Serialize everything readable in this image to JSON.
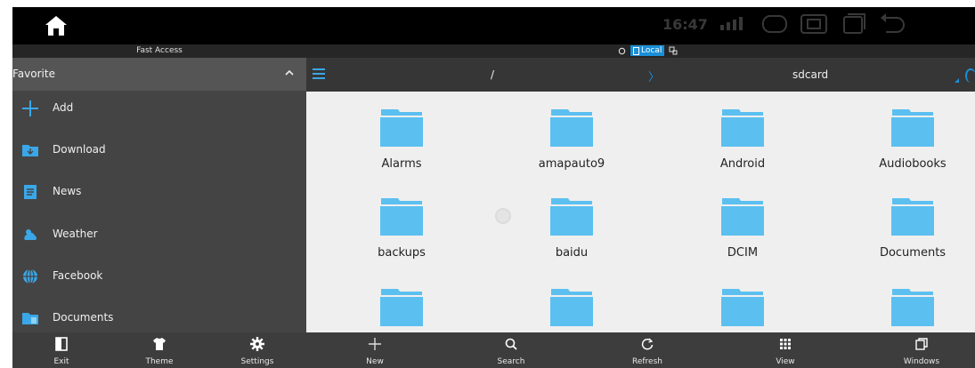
{
  "status_bar": {
    "home_icon": "home-icon",
    "time": "16:47"
  },
  "fast_access": {
    "title": "Fast Access"
  },
  "location": {
    "label": "Local"
  },
  "favorites": {
    "title": "Favorite",
    "items": [
      {
        "label": "Add",
        "icon": "plus-icon"
      },
      {
        "label": "Download",
        "icon": "download-folder-icon"
      },
      {
        "label": "News",
        "icon": "news-icon"
      },
      {
        "label": "Weather",
        "icon": "weather-icon"
      },
      {
        "label": "Facebook",
        "icon": "globe-icon"
      },
      {
        "label": "Documents",
        "icon": "documents-folder-icon"
      }
    ]
  },
  "path_bar": {
    "root": "/",
    "separator": "〉",
    "current": "sdcard"
  },
  "files": [
    {
      "name": "Alarms"
    },
    {
      "name": "amapauto9"
    },
    {
      "name": "Android"
    },
    {
      "name": "Audiobooks"
    },
    {
      "name": "backups"
    },
    {
      "name": "baidu"
    },
    {
      "name": "DCIM"
    },
    {
      "name": "Documents"
    },
    {
      "name": ""
    },
    {
      "name": ""
    },
    {
      "name": ""
    },
    {
      "name": ""
    }
  ],
  "bottom_left": [
    {
      "label": "Exit",
      "icon": "exit-icon"
    },
    {
      "label": "Theme",
      "icon": "tshirt-icon"
    },
    {
      "label": "Settings",
      "icon": "gear-icon"
    }
  ],
  "bottom_right": [
    {
      "label": "New",
      "icon": "plus-icon"
    },
    {
      "label": "Search",
      "icon": "search-icon"
    },
    {
      "label": "Refresh",
      "icon": "refresh-icon"
    },
    {
      "label": "View",
      "icon": "grid-icon"
    },
    {
      "label": "Windows",
      "icon": "windows-icon"
    }
  ],
  "colors": {
    "accent": "#1a8fd8",
    "folder": "#5bc0f0",
    "panel": "#444444",
    "content_bg": "#efefef"
  }
}
